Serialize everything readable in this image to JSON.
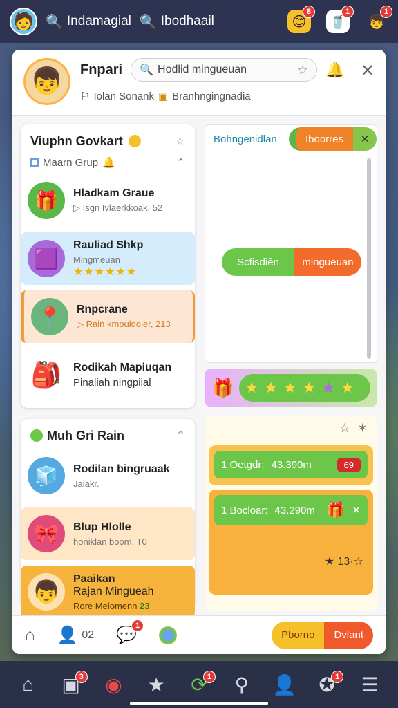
{
  "topbar": {
    "search1": "Indamagial",
    "search2": "Ibodhaail",
    "icons": [
      {
        "name": "emoji-icon",
        "badge": "8"
      },
      {
        "name": "cup-icon",
        "badge": "1"
      },
      {
        "name": "profile-icon",
        "badge": "1"
      }
    ]
  },
  "panel": {
    "name": "Fnpari",
    "search_placeholder": "Hodlid mingueuan",
    "subline_a": "Iolan Sonank",
    "subline_b": "Branhngingnadia"
  },
  "group1": {
    "title": "Viuphn Govkart",
    "subtitle": "Maarn Grup",
    "items": [
      {
        "title": "Hladkam Graue",
        "sub": "Isgn Ivlaerkkoak, 52"
      },
      {
        "title": "Rauliad Shkp",
        "sub": "Mingmeuan"
      },
      {
        "title": "Rnpcrane",
        "sub": "Rain kmpuldoier, 213"
      },
      {
        "title": "Rodikah Mapiuqan",
        "sub": "Pinaliah ningpiial"
      }
    ]
  },
  "group2": {
    "title": "Muh Gri Rain",
    "items": [
      {
        "title": "Rodilan bingruaak",
        "sub": "Jaiakr."
      },
      {
        "title": "Blup Hlolle",
        "sub": "honiklan boom, T0"
      },
      {
        "title": "Paaikan",
        "title2": "Rajan Mingueah",
        "sub": "Rore Melomenn",
        "sub_num": "23"
      }
    ]
  },
  "right": {
    "tab_label": "Bohngenidlan",
    "tab_active": "Iboorres",
    "btn_green": "Scfisdiên",
    "btn_orange": "mingueuan",
    "reward1_label": "1 Oetgdr:",
    "reward1_value": "43.390m",
    "reward1_tag": "69",
    "reward2_label": "1 Bocloar:",
    "reward2_value": "43.290m",
    "reward2_count": "★ 13·☆"
  },
  "footer": {
    "count": "02",
    "chat_badge": "1",
    "btn_yellow": "Pborno",
    "btn_red": "Dvlant"
  },
  "navbar": {
    "badges": [
      "3",
      "1",
      "1"
    ]
  },
  "colors": {
    "accent_green": "#6cc64a",
    "accent_orange": "#f36b2a",
    "accent_gold": "#f7b43c",
    "badge_red": "#e43a3a"
  }
}
